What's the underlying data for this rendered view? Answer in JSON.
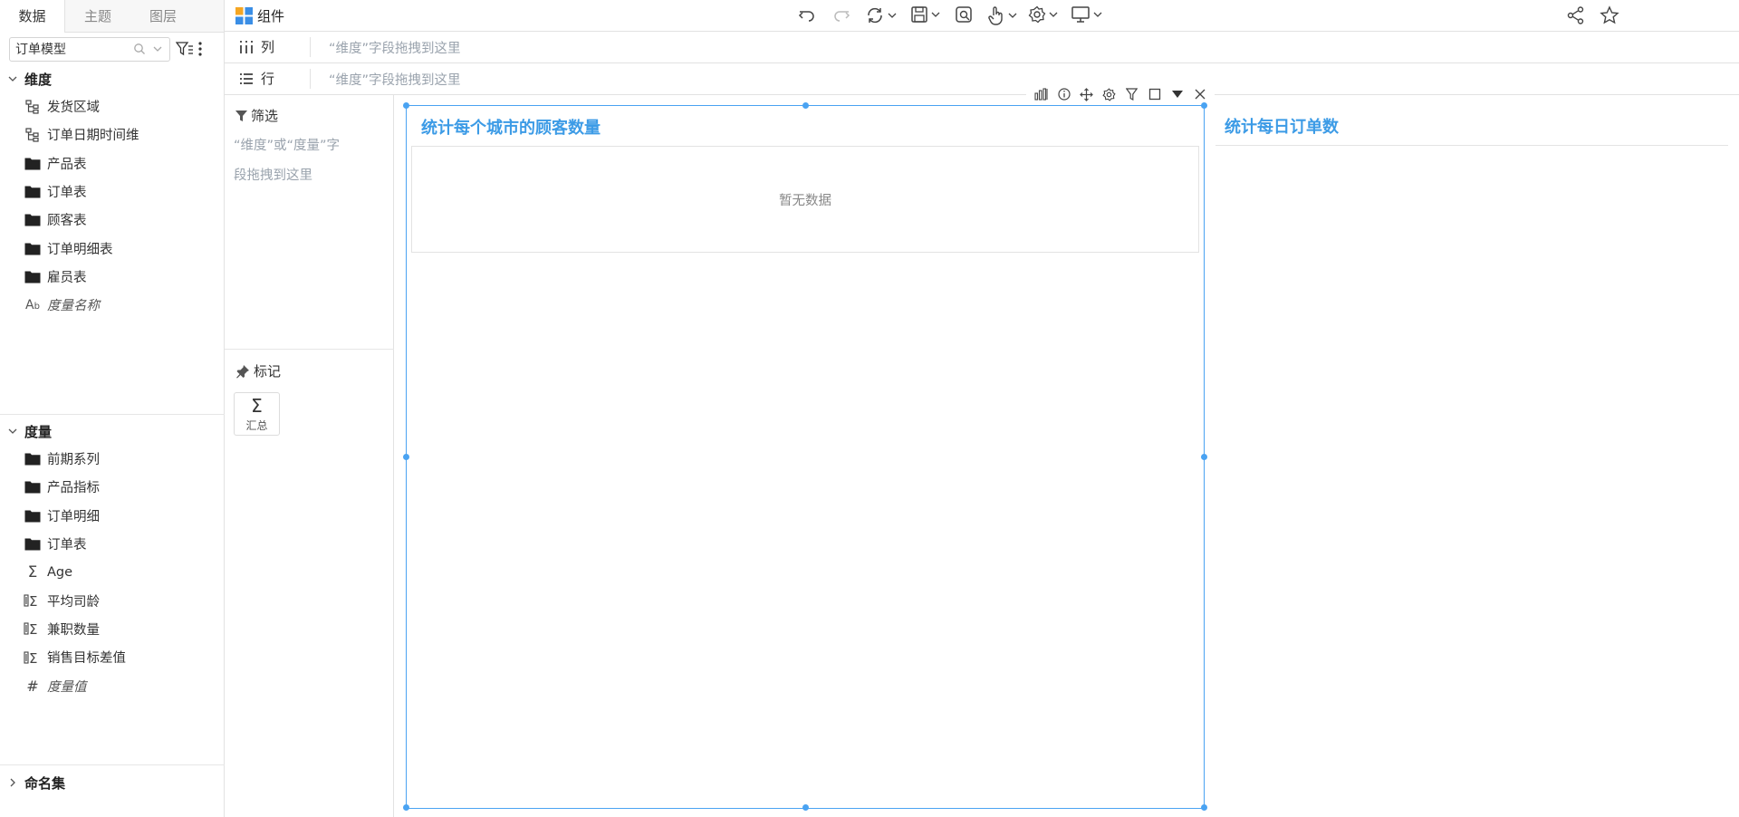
{
  "left_panel": {
    "tabs": [
      {
        "label": "数据",
        "active": true
      },
      {
        "label": "主题",
        "active": false
      },
      {
        "label": "图层",
        "active": false
      }
    ],
    "model_select": {
      "value": "订单模型"
    },
    "dimensions": {
      "title": "维度",
      "items": [
        {
          "label": "发货区域",
          "icon": "hierarchy-icon"
        },
        {
          "label": "订单日期时间维",
          "icon": "hierarchy-icon"
        },
        {
          "label": "产品表",
          "icon": "folder-icon"
        },
        {
          "label": "订单表",
          "icon": "folder-icon"
        },
        {
          "label": "顾客表",
          "icon": "folder-icon"
        },
        {
          "label": "订单明细表",
          "icon": "folder-icon"
        },
        {
          "label": "雇员表",
          "icon": "folder-icon"
        },
        {
          "label": "度量名称",
          "icon": "text-field-icon",
          "italic": true
        }
      ]
    },
    "measures": {
      "title": "度量",
      "items": [
        {
          "label": "前期系列",
          "icon": "folder-icon"
        },
        {
          "label": "产品指标",
          "icon": "folder-icon"
        },
        {
          "label": "订单明细",
          "icon": "folder-icon"
        },
        {
          "label": "订单表",
          "icon": "folder-icon"
        },
        {
          "label": "Age",
          "icon": "sigma-icon"
        },
        {
          "label": "平均司龄",
          "icon": "calc-sigma-icon"
        },
        {
          "label": "兼职数量",
          "icon": "calc-sigma-icon"
        },
        {
          "label": "销售目标差值",
          "icon": "calc-sigma-icon"
        },
        {
          "label": "度量值",
          "icon": "hash-icon",
          "italic": true
        }
      ]
    },
    "named_sets": {
      "title": "命名集"
    }
  },
  "toolbar": {
    "component_label": "组件"
  },
  "shelves": {
    "columns": {
      "label": "列",
      "hint": "“维度”字段拖拽到这里"
    },
    "rows": {
      "label": "行",
      "hint": "“维度”字段拖拽到这里"
    }
  },
  "filter_panel": {
    "title": "筛选",
    "hint_line1": "“维度”或“度量”字",
    "hint_line2": "段拖拽到这里"
  },
  "marks_panel": {
    "title": "标记",
    "card_symbol": "Σ",
    "card_label": "汇总"
  },
  "canvas": {
    "widget1": {
      "title": "统计每个城市的顾客数量",
      "empty_text": "暂无数据"
    },
    "widget2": {
      "title": "统计每日订单数"
    }
  },
  "colors": {
    "accent": "#4aa3f2",
    "title_blue": "#3c9be6",
    "hint_gray": "#9aa3ad"
  }
}
